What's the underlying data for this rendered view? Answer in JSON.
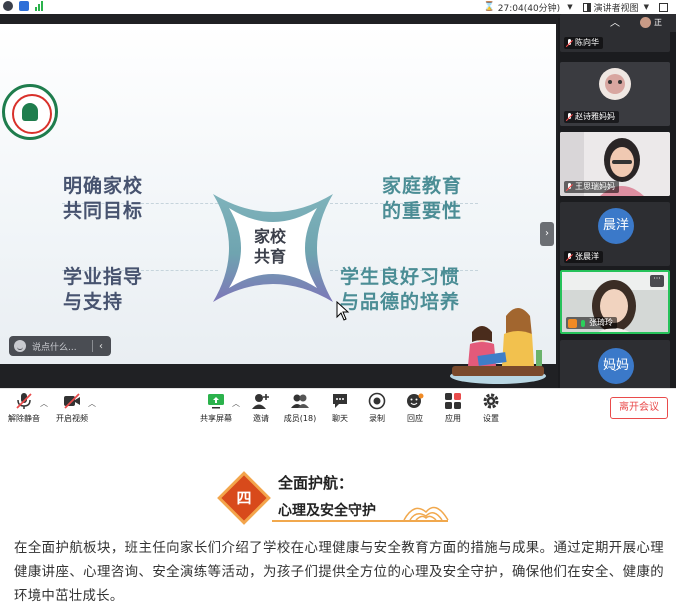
{
  "topbar": {
    "timer": "27:04(40分钟)",
    "presenter_view": "演讲者视图"
  },
  "slide": {
    "item1_l1": "明确家校",
    "item1_l2": "共同目标",
    "item2_l1": "家庭教育",
    "item2_l2": "的重要性",
    "item3_l1": "学业指导",
    "item3_l2": "与支持",
    "item4_l1": "学生良好习惯",
    "item4_l2": "与品德的培养",
    "hub_l1": "家校",
    "hub_l2": "共育"
  },
  "chat": {
    "placeholder": "说点什么..."
  },
  "participants": {
    "self_label": "正",
    "tiles": [
      {
        "name": "陈向华"
      },
      {
        "name": "赵诗雅妈妈"
      },
      {
        "name": "王思瑞妈妈"
      },
      {
        "name": "张晨洋",
        "avatar": "晨洋",
        "avatar_color": "#3b79c9"
      },
      {
        "name": "张琦玲"
      },
      {
        "name": "",
        "avatar": "妈妈",
        "avatar_color": "#3b79c9"
      }
    ]
  },
  "toolbar": {
    "mute": "解除静音",
    "video": "开启视频",
    "share": "共享屏幕",
    "invite": "邀请",
    "members": "成员(18)",
    "chat": "聊天",
    "record": "录制",
    "reply": "回应",
    "apps": "应用",
    "settings": "设置",
    "leave": "离开会议"
  },
  "article": {
    "badge": "四",
    "heading_l1": "全面护航：",
    "heading_l2": "心理及安全守护",
    "body": "在全面护航板块，班主任向家长们介绍了学校在心理健康与安全教育方面的措施与成果。通过定期开展心理健康讲座、心理咨询、安全演练等活动，为孩子们提供全方位的心理及安全守护，确保他们在安全、健康的环境中茁壮成长。"
  },
  "colors": {
    "accent_red": "#e94b4b",
    "active_speaker": "#26c25a",
    "badge_orange": "#d84a1b"
  }
}
